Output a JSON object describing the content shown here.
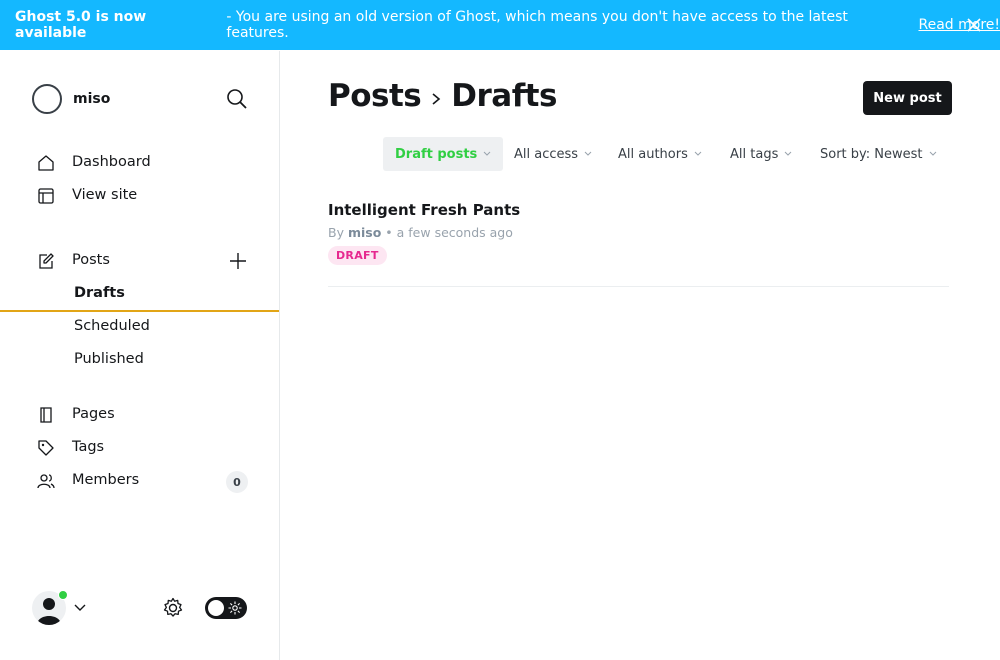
{
  "banner": {
    "headline": "Ghost 5.0 is now available",
    "message": "- You are using an old version of Ghost, which means you don't have access to the latest features.",
    "link": "Read more!"
  },
  "sidebar": {
    "site_name": "miso",
    "nav": {
      "dashboard": "Dashboard",
      "view_site": "View site",
      "posts": "Posts",
      "drafts": "Drafts",
      "scheduled": "Scheduled",
      "published": "Published",
      "pages": "Pages",
      "tags": "Tags",
      "members": "Members",
      "members_count": "0"
    },
    "accent_color": "#e2a516"
  },
  "header": {
    "crumb_parent": "Posts",
    "crumb_current": "Drafts",
    "new_post": "New post"
  },
  "filters": {
    "type": "Draft posts",
    "access": "All access",
    "authors": "All authors",
    "tags": "All tags",
    "sort": "Sort by: Newest"
  },
  "posts": [
    {
      "title": "Intelligent Fresh Pants",
      "by": "By",
      "author": "miso",
      "time": "• a few seconds ago",
      "status": "DRAFT"
    }
  ],
  "colors": {
    "banner": "#14b8ff",
    "active_filter": "#30cf43",
    "draft_pill_bg": "#fde6f2",
    "draft_pill_text": "#e6288f"
  }
}
